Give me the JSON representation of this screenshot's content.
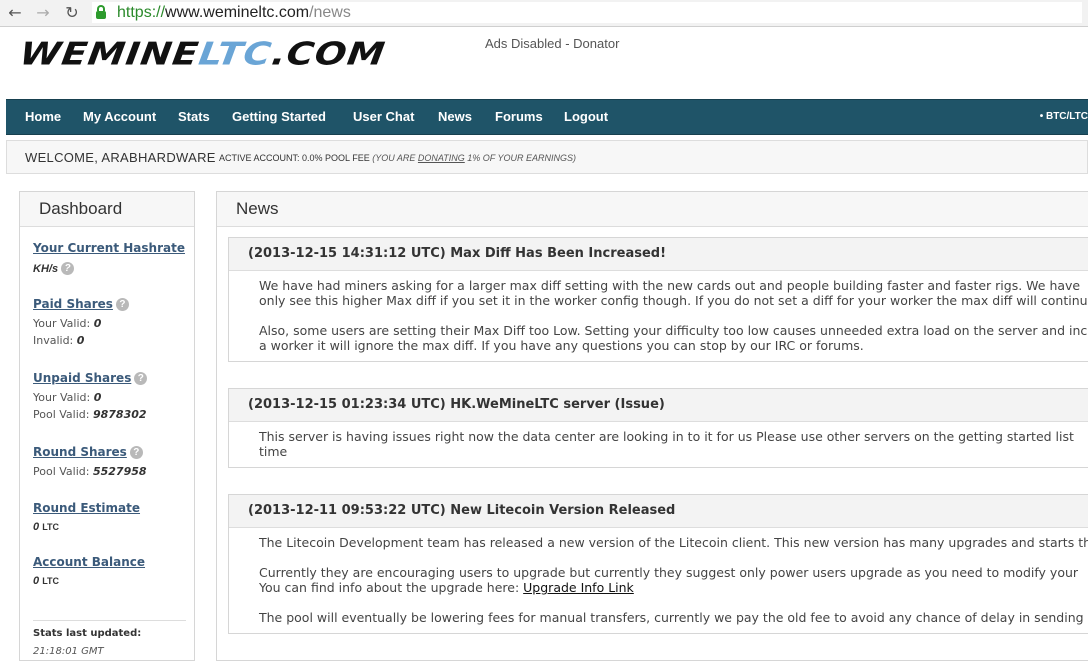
{
  "browser": {
    "url_protocol": "https://",
    "url_host": "www.wemineltc.com",
    "url_path": "/news"
  },
  "header": {
    "logo_part1": "WEMINE",
    "logo_part2": "LTC",
    "logo_part3": ".COM",
    "ads_text": "Ads Disabled - Donator"
  },
  "nav": {
    "items": [
      "Home",
      "My Account",
      "Stats",
      "Getting Started",
      "User Chat",
      "News",
      "Forums",
      "Logout"
    ],
    "ticker": "• BTC/LTC"
  },
  "welcome": {
    "user": "WELCOME, ARABHARDWARE",
    "status_prefix": "ACTIVE ACCOUNT: 0.0% POOL FEE",
    "donate_open": "(YOU ARE",
    "donate_link": "DONATING",
    "donate_close": "1% OF YOUR EARNINGS)"
  },
  "dashboard": {
    "title": "Dashboard",
    "hashrate": {
      "title": "Your Current Hashrate",
      "unit": "KH/s"
    },
    "paid": {
      "title": "Paid Shares",
      "valid_label": "Your Valid:",
      "valid_value": "0",
      "invalid_label": "Invalid:",
      "invalid_value": "0"
    },
    "unpaid": {
      "title": "Unpaid Shares",
      "valid_label": "Your Valid:",
      "valid_value": "0",
      "pool_label": "Pool Valid:",
      "pool_value": "9878302"
    },
    "round": {
      "title": "Round Shares",
      "pool_label": "Pool Valid:",
      "pool_value": "5527958"
    },
    "estimate": {
      "title": "Round Estimate",
      "value": "0",
      "unit": "LTC"
    },
    "balance": {
      "title": "Account Balance",
      "value": "0",
      "unit": "LTC"
    },
    "updated_label": "Stats last updated:",
    "updated_time": "21:18:01 GMT"
  },
  "news": {
    "title": "News",
    "articles": [
      {
        "title": "(2013-12-15 14:31:12 UTC) Max Diff Has Been Increased!",
        "p1a": "We have had miners asking for a larger max diff setting with the new cards out and people building faster and faster rigs. We have",
        "p1b": "only see this higher Max diff if you set it in the worker config though. If you do not set a diff for your worker the max diff will continu",
        "p2a": "Also, some users are setting their Max Diff too Low. Setting your difficulty too low causes unneeded extra load on the server and inc",
        "p2b": "a worker it will ignore the max diff. If you have any questions you can stop by our IRC or forums."
      },
      {
        "title": "(2013-12-15 01:23:34 UTC) HK.WeMineLTC server (Issue)",
        "p1a": "This server is having issues right now the data center are looking in to it for us Please use other servers on the getting started list",
        "p1b": "time"
      },
      {
        "title": "(2013-12-11 09:53:22 UTC) New Litecoin Version Released",
        "p1a": "The Litecoin Development team has released a new version of the Litecoin client. This new version has many upgrades and starts th",
        "p2a": "Currently they are encouraging users to upgrade but currently they suggest only power users upgrade as you need to modify your",
        "p2b": "You can find info about the upgrade here:",
        "link": "Upgrade Info Link",
        "p3a": "The pool will eventually be lowering fees for manual transfers, currently we pay the old fee to avoid any chance of delay in sending"
      }
    ]
  }
}
